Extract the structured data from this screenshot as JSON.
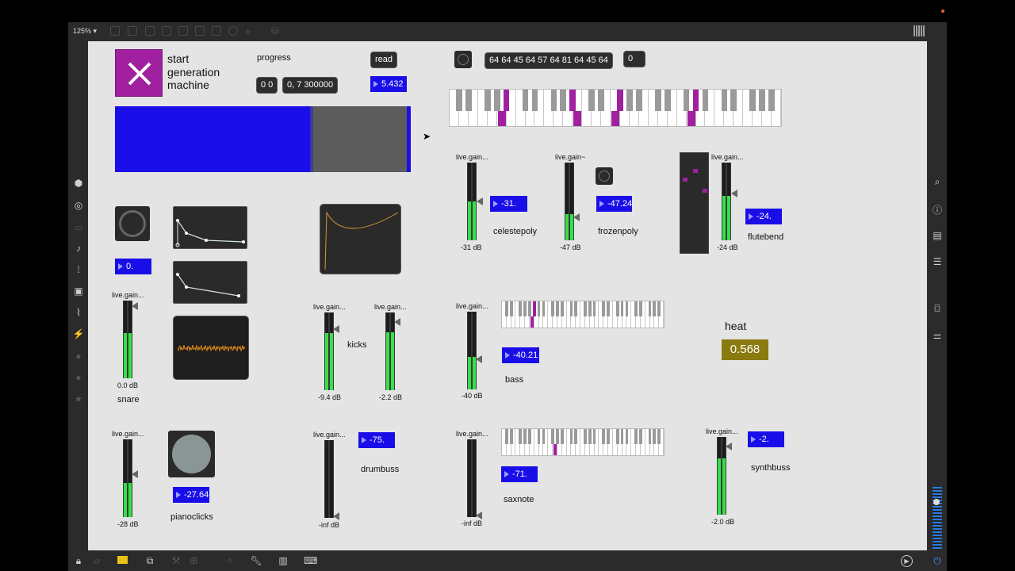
{
  "toolbar": {
    "zoom": "125% ▾"
  },
  "start": {
    "label_line1": "start",
    "label_line2": "generation",
    "label_line3": "machine"
  },
  "progress": {
    "label": "progress",
    "msg1": "0 0",
    "msg2": "0, 7 300000",
    "read": "read",
    "value": "5.432",
    "fraction": 0.68
  },
  "notes": {
    "list": "64 64 45 64 57 64 81 64 45 64",
    "count": "0"
  },
  "celestepoly": {
    "gain_label": "live.gain...",
    "db": "-31 dB",
    "num": "-31.",
    "name": "celestepoly"
  },
  "frozenpoly": {
    "gain_label": "live.gain~",
    "db": "-47 dB",
    "num": "-47.24",
    "name": "frozenpoly"
  },
  "flutebend": {
    "gain_label": "live.gain...",
    "db": "-24 dB",
    "num": "-24.",
    "name": "flutebend"
  },
  "snare": {
    "gain_label": "live.gain...",
    "db": "0.0 dB",
    "num": "0.",
    "name": "snare"
  },
  "kicks": {
    "gain1_label": "live.gain...",
    "db1": "-9.4 dB",
    "gain2_label": "live.gain...",
    "db2": "-2.2 dB",
    "name": "kicks"
  },
  "bass": {
    "gain_label": "live.gain...",
    "db": "-40 dB",
    "num": "-40.21",
    "name": "bass"
  },
  "heat": {
    "label": "heat",
    "value": "0.568"
  },
  "pianoclicks": {
    "gain_label": "live.gain...",
    "db": "-28 dB",
    "num": "-27.64",
    "name": "pianoclicks"
  },
  "drumbuss": {
    "gain_label": "live.gain...",
    "db": "-inf dB",
    "num": "-75.",
    "name": "drumbuss"
  },
  "saxnote": {
    "gain_label": "live.gain...",
    "db": "-inf dB",
    "num": "-71.",
    "name": "saxnote"
  },
  "synthbuss": {
    "gain_label": "live.gain...",
    "db": "-2.0 dB",
    "num": "-2.",
    "name": "synthbuss"
  },
  "colors": {
    "accent_blue": "#1a0ee8",
    "toggle_purple": "#a020a0",
    "meter_green": "#35e04a",
    "heat_bg": "#8a7a10"
  }
}
